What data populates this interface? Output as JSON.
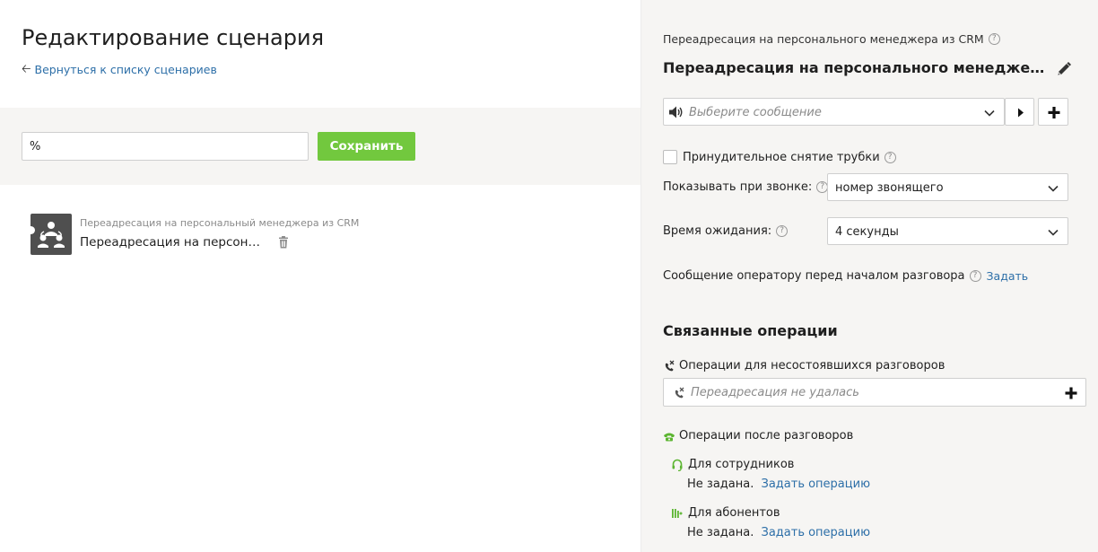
{
  "page": {
    "title": "Редактирование сценария",
    "back_link": "Вернуться к списку сценариев"
  },
  "toolbar": {
    "name_value": "%",
    "save_label": "Сохранить"
  },
  "scenario_item": {
    "subtitle": "Переадресация на персональный менеджера из CRM",
    "name": "Переадресация на персональ..."
  },
  "panel": {
    "op_type_label": "Переадресация на персонального менеджера из CRM",
    "op_title": "Переадресация на персонального менеджера из CRM",
    "message_placeholder": "Выберите сообщение",
    "force_hangup_label": "Принудительное снятие трубки",
    "show_on_call_label": "Показывать при звонке:",
    "show_on_call_value": "номер звонящего",
    "wait_time_label": "Время ожидания:",
    "wait_time_value": "4 секунды",
    "operator_msg_label": "Сообщение оператору перед началом разговора",
    "operator_msg_link": "Задать",
    "help_glyph": "?"
  },
  "related": {
    "heading": "Связанные операции",
    "failed_heading": "Операции для несостоявшихся разговоров",
    "failed_placeholder": "Переадресация не удалась",
    "after_heading": "Операции после разговоров",
    "employees": {
      "label": "Для сотрудников",
      "status": "Не задана.",
      "link": "Задать операцию"
    },
    "subscribers": {
      "label": "Для абонентов",
      "status": "Не задана.",
      "link": "Задать операцию"
    }
  },
  "colors": {
    "accent_green": "#72c83e",
    "link_blue": "#2d6fa8",
    "icon_green": "#5cb531",
    "panel_bg": "#f6f5f3"
  }
}
